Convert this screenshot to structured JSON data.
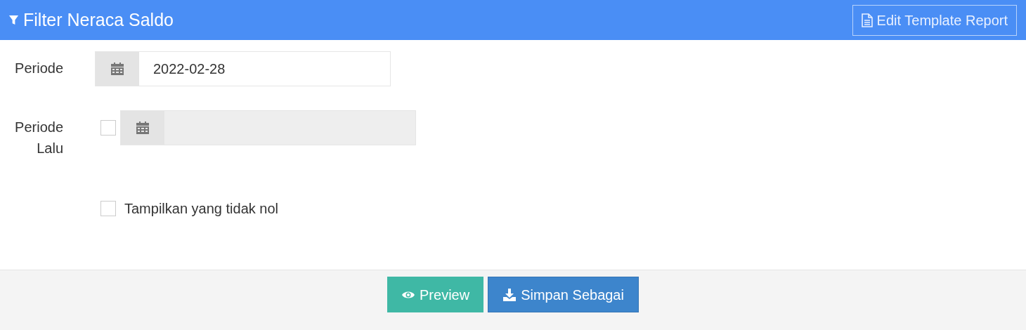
{
  "header": {
    "title": "Filter Neraca Saldo",
    "action_button": "Edit Template Report"
  },
  "fields": [
    {
      "label": "Periode",
      "value": "2022-02-28",
      "disabled": false
    },
    {
      "label": "Periode Lalu",
      "checked": false,
      "disabled": true
    }
  ],
  "options": [
    {
      "label": "Tampilkan yang tidak nol",
      "checked": false
    }
  ],
  "footer_buttons": [
    {
      "kind": "preview",
      "label": "Preview"
    },
    {
      "kind": "save",
      "label": "Simpan Sebagai"
    }
  ]
}
